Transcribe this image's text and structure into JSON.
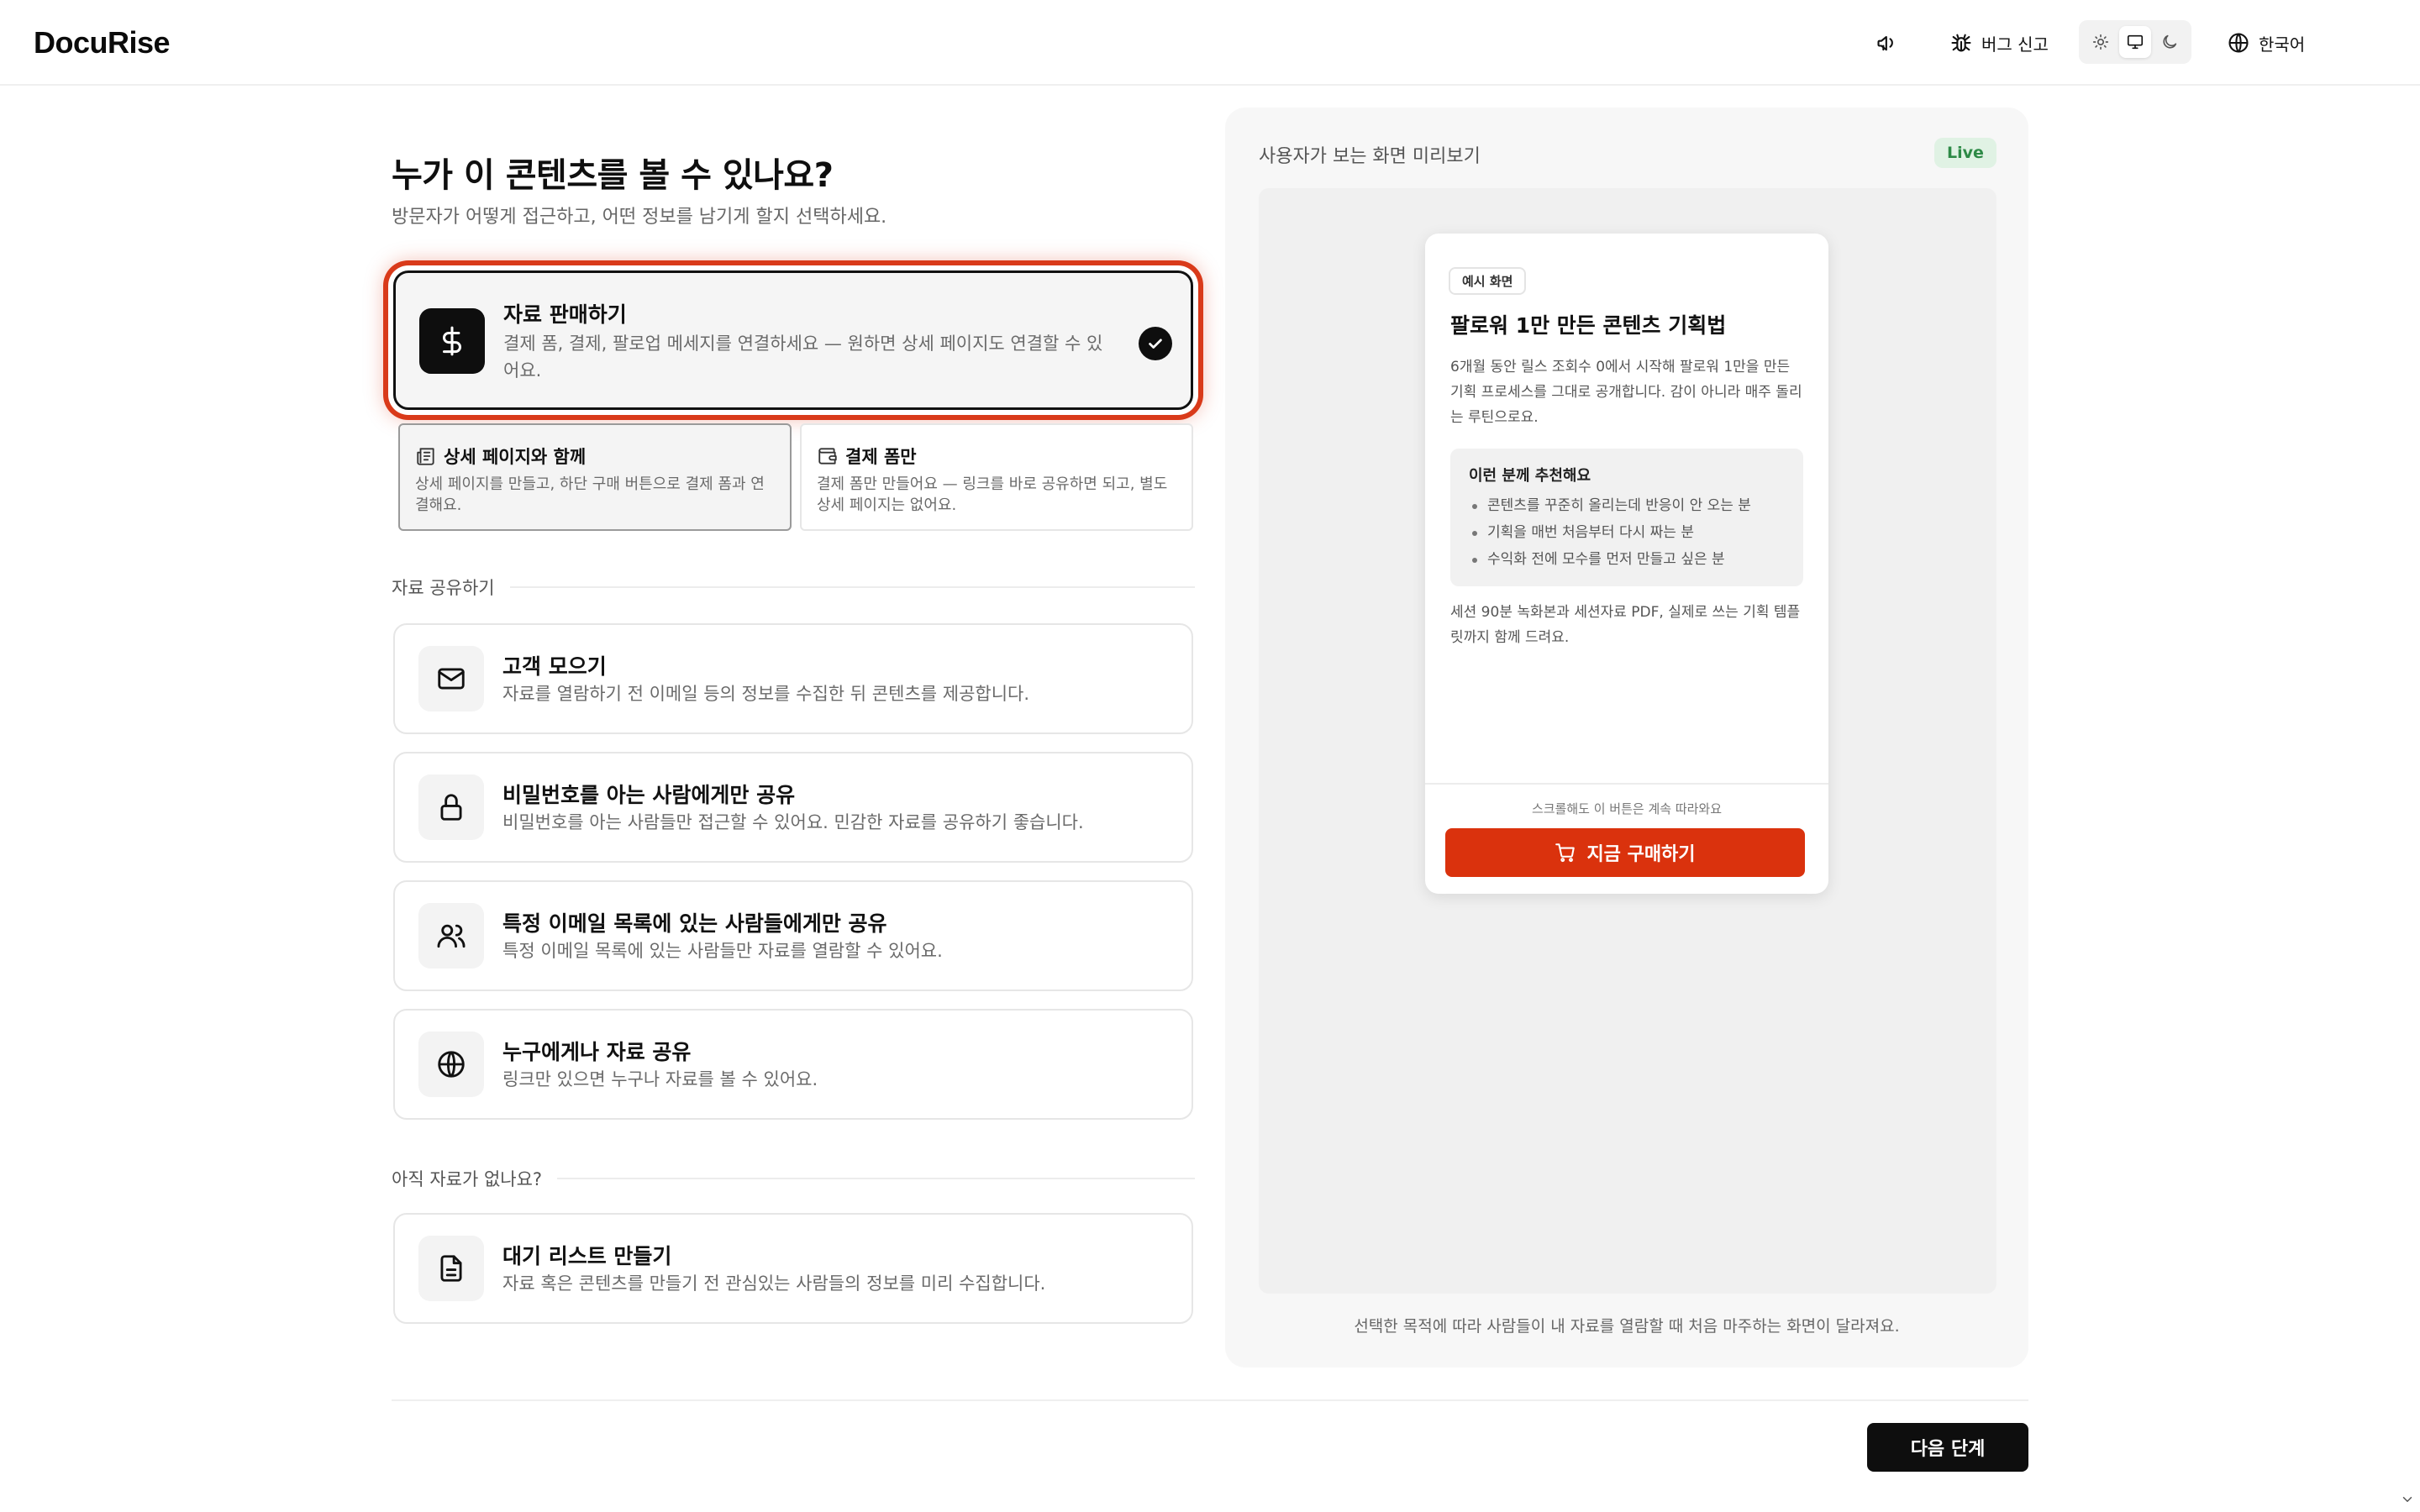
{
  "header": {
    "logo": "DocuRise",
    "bug_report": "버그 신고",
    "language": "한국어",
    "theme_options": [
      "light",
      "system",
      "dark"
    ],
    "theme_selected": "system"
  },
  "main": {
    "title": "누가 이 콘텐츠를 볼 수 있나요?",
    "subtitle": "방문자가 어떻게 접근하고, 어떤 정보를 남기게 할지 선택하세요.",
    "selected_option": {
      "title": "자료 판매하기",
      "desc": "결제 폼, 결제, 팔로업 메세지를 연결하세요 — 원하면 상세 페이지도 연결할 수 있어요."
    },
    "sub_options": [
      {
        "title": "상세 페이지와 함께",
        "desc": "상세 페이지를 만들고, 하단 구매 버튼으로 결제 폼과 연결해요.",
        "selected": true
      },
      {
        "title": "결제 폼만",
        "desc": "결제 폼만 만들어요 — 링크를 바로 공유하면 되고, 별도 상세 페이지는 없어요.",
        "selected": false
      }
    ],
    "share_section": {
      "label": "자료 공유하기",
      "options": [
        {
          "title": "고객 모으기",
          "desc": "자료를 열람하기 전 이메일 등의 정보를 수집한 뒤 콘텐츠를 제공합니다.",
          "icon": "mail-icon"
        },
        {
          "title": "비밀번호를 아는 사람에게만 공유",
          "desc": "비밀번호를 아는 사람들만 접근할 수 있어요. 민감한 자료를 공유하기 좋습니다.",
          "icon": "lock-icon"
        },
        {
          "title": "특정 이메일 목록에 있는 사람들에게만 공유",
          "desc": "특정 이메일 목록에 있는 사람들만 자료를 열람할 수 있어요.",
          "icon": "users-icon"
        },
        {
          "title": "누구에게나 자료 공유",
          "desc": "링크만 있으면 누구나 자료를 볼 수 있어요.",
          "icon": "globe-icon"
        }
      ]
    },
    "waitlist_section": {
      "label": "아직 자료가 없나요?",
      "option": {
        "title": "대기 리스트 만들기",
        "desc": "자료 혹은 콘텐츠를 만들기 전 관심있는 사람들의 정보를 미리 수집합니다.",
        "icon": "document-icon"
      }
    }
  },
  "preview": {
    "label": "사용자가 보는 화면 미리보기",
    "live_badge": "Live",
    "footer": "선택한 목적에 따라 사람들이 내 자료를 열람할 때 처음 마주하는 화면이 달라져요.",
    "sample": {
      "badge": "예시 화면",
      "title": "팔로워 1만 만든 콘텐츠 기획법",
      "body": "6개월 동안 릴스 조회수 0에서 시작해 팔로워 1만을 만든 기획 프로세스를 그대로 공개합니다. 감이 아니라 매주 돌리는 루틴으로요.",
      "recommend_title": "이런 분께 추천해요",
      "recommend_items": [
        "콘텐츠를 꾸준히 올리는데 반응이 안 오는 분",
        "기획을 매번 처음부터 다시 짜는 분",
        "수익화 전에 모수를 먼저 만들고 싶은 분"
      ],
      "body2": "세션 90분 녹화본과 세션자료 PDF, 실제로 쓰는 기획 템플릿까지 함께 드려요.",
      "scroll_note": "스크롤해도 이 버튼은 계속 따라와요",
      "buy_button": "지금 구매하기"
    }
  },
  "footer": {
    "next_button": "다음 단계"
  }
}
